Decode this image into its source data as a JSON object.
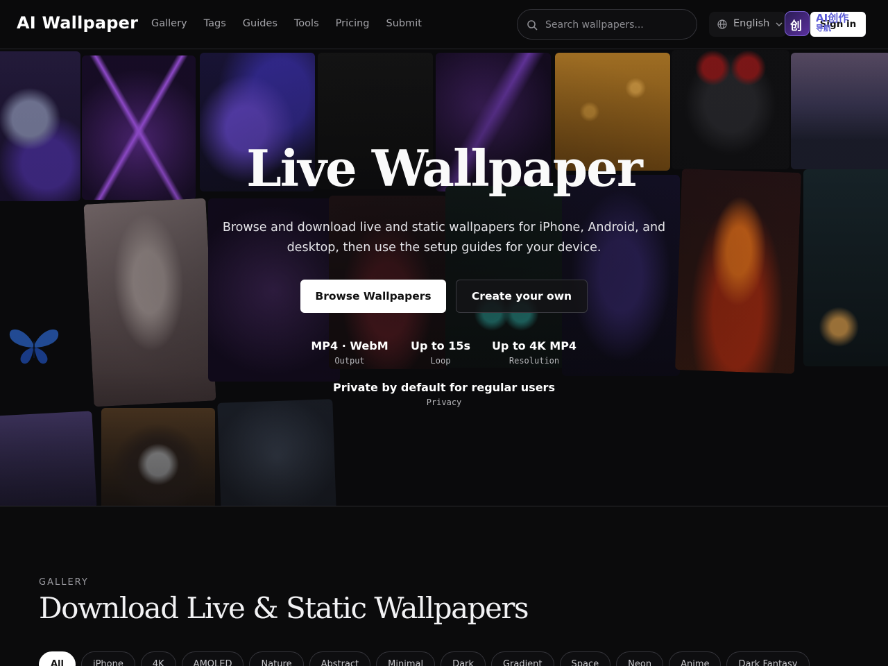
{
  "nav": {
    "logo": "AI Wallpaper",
    "links": [
      "Gallery",
      "Tags",
      "Guides",
      "Tools",
      "Pricing",
      "Submit"
    ],
    "search_placeholder": "Search wallpapers...",
    "language": "English",
    "sign_in": "Sign in",
    "watermark": {
      "icon_text": "创",
      "line1": "AI创作",
      "line2": "导航"
    }
  },
  "hero": {
    "title": "Live Wallpaper",
    "subtitle": "Browse and download live and static wallpapers for iPhone, Android, and desktop, then use the setup guides for your device.",
    "primary_button": "Browse Wallpapers",
    "secondary_button": "Create your own",
    "stats": [
      {
        "value": "MP4 · WebM",
        "label": "Output"
      },
      {
        "value": "Up to 15s",
        "label": "Loop"
      },
      {
        "value": "Up to 4K MP4",
        "label": "Resolution"
      },
      {
        "value": "Private by default for regular users",
        "label": "Privacy"
      }
    ]
  },
  "gallery": {
    "eyebrow": "GALLERY",
    "title": "Download Live & Static Wallpapers",
    "filters": [
      "All",
      "iPhone",
      "4K",
      "AMOLED",
      "Nature",
      "Abstract",
      "Minimal",
      "Dark",
      "Gradient",
      "Space",
      "Neon",
      "Anime",
      "Dark Fantasy"
    ],
    "active_filter": "All"
  },
  "colors": {
    "background": "#0b0b0c",
    "primary_button": "#ffffff",
    "accent_watermark": "#5b5bd6"
  }
}
